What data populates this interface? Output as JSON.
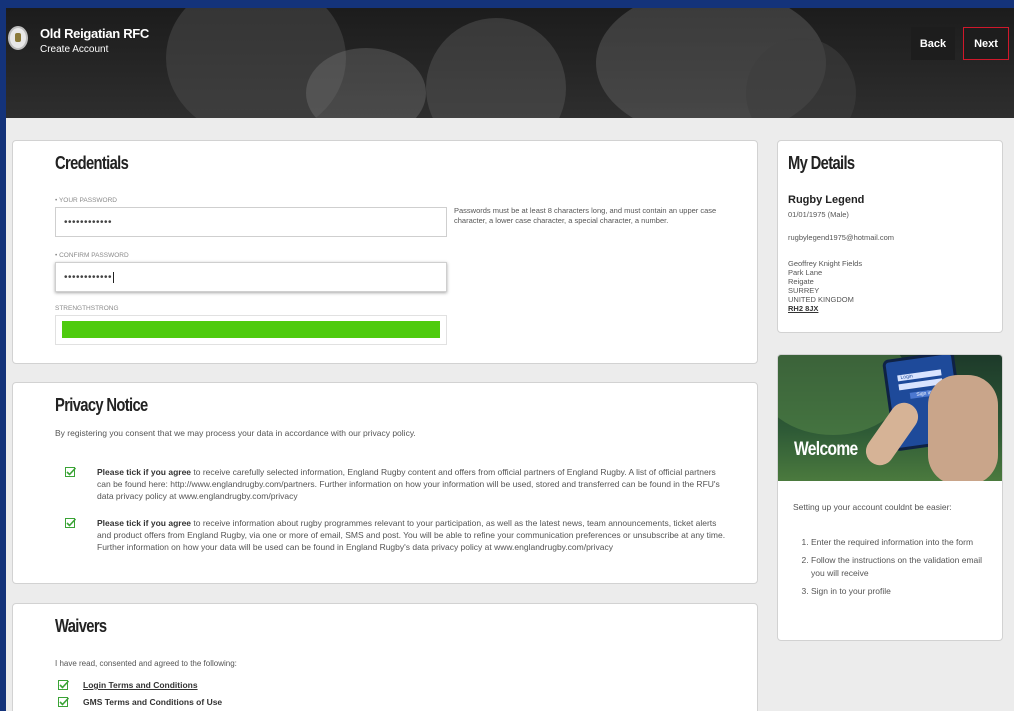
{
  "header": {
    "club_name": "Old Reigatian RFC",
    "subtitle": "Create Account",
    "back_label": "Back",
    "next_label": "Next"
  },
  "credentials": {
    "title": "Credentials",
    "password_label": "• YOUR PASSWORD",
    "password_value": "••••••••••••",
    "confirm_label": "• CONFIRM PASSWORD",
    "confirm_value": "••••••••••••",
    "hint": "Passwords must be at least 8 characters long, and must contain an upper case character, a lower case character, a special character, a number.",
    "strength_label": "STRENGTHSTRONG",
    "strength_fraction": 1.0,
    "strength_color": "#4ecb0e"
  },
  "privacy": {
    "title": "Privacy Notice",
    "intro": "By registering you consent that we may process your data in accordance with our privacy policy.",
    "items": [
      {
        "lead": "Please tick if you agree",
        "text": " to receive carefully selected information, England Rugby content and offers from official partners of England Rugby. A list of official partners can be found here: http://www.englandrugby.com/partners. Further information on how your information will be used, stored and transferred can be found in the RFU's data privacy policy at www.englandrugby.com/privacy",
        "checked": true
      },
      {
        "lead": "Please tick if you agree",
        "text": " to receive information about rugby programmes relevant to your participation, as well as the latest news, team announcements, ticket alerts and product offers from England Rugby, via one or more of email, SMS and post. You will be able to refine your communication preferences or unsubscribe at any time. Further information on how your data will be used can be found in England Rugby's data privacy policy at www.englandrugby.com/privacy",
        "checked": true
      }
    ]
  },
  "waivers": {
    "title": "Waivers",
    "intro": "I have read, consented and agreed to the following:",
    "items": [
      {
        "label": "Login Terms and Conditions",
        "checked": true
      },
      {
        "label": "GMS Terms and Conditions of Use",
        "checked": true
      }
    ]
  },
  "details": {
    "title": "My Details",
    "name": "Rugby Legend",
    "dob": "01/01/1975 (Male)",
    "email": "rugbylegend1975@hotmail.com",
    "address": [
      "Geoffrey Knight Fields",
      "Park Lane",
      "Reigate",
      "SURREY",
      "UNITED KINGDOM"
    ],
    "postcode": "RH2 8JX"
  },
  "welcome": {
    "title": "Welcome",
    "intro": "Setting up your account couldnt be easier:",
    "steps": [
      "Enter the required information into the form",
      "Follow the instructions on the validation email you will receive",
      "Sign in to your profile"
    ],
    "phone_screen": [
      "Login",
      "Sign in"
    ]
  },
  "colors": {
    "accent_red": "#d0182b",
    "check_green": "#3aa335",
    "page_blue": "#14337a"
  }
}
